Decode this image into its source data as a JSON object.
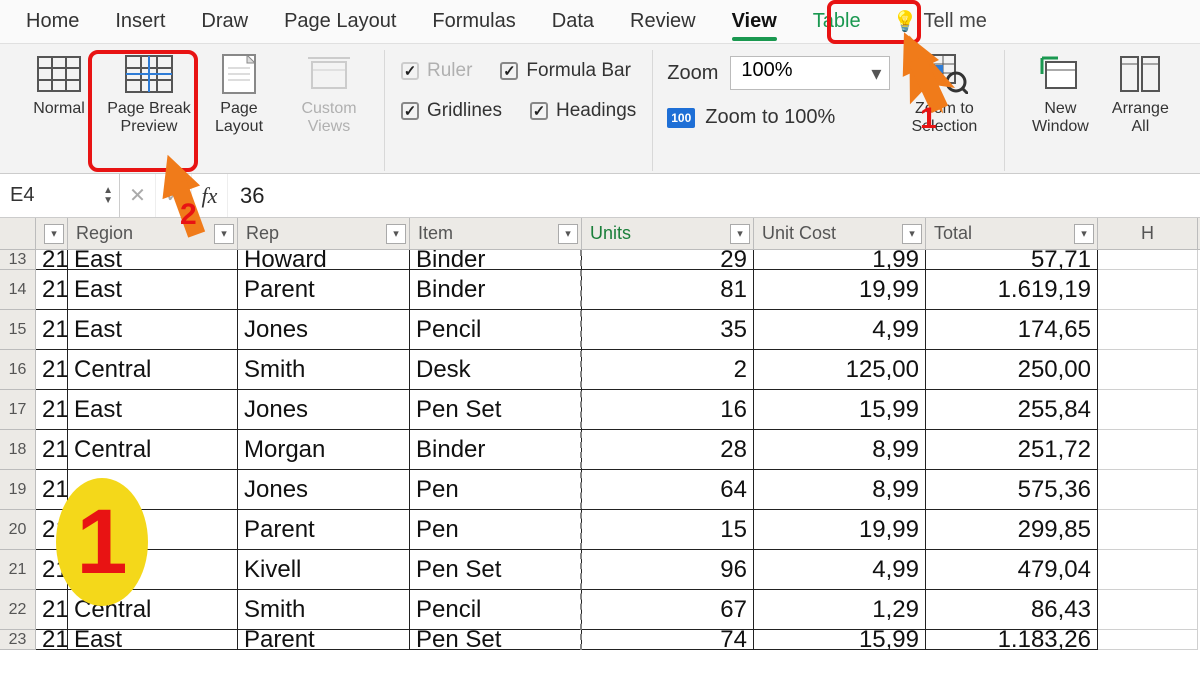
{
  "menu": {
    "items": [
      "Home",
      "Insert",
      "Draw",
      "Page Layout",
      "Formulas",
      "Data",
      "Review",
      "View",
      "Table"
    ],
    "active": "View",
    "tellme": "Tell me"
  },
  "ribbon": {
    "views": {
      "normal": "Normal",
      "page_break": "Page Break\nPreview",
      "page_layout": "Page\nLayout",
      "custom_views": "Custom\nViews"
    },
    "show": {
      "ruler": "Ruler",
      "formula_bar": "Formula Bar",
      "gridlines": "Gridlines",
      "headings": "Headings"
    },
    "zoom": {
      "label": "Zoom",
      "value": "100%",
      "to100": "Zoom to 100%",
      "to_selection": "Zoom to\nSelection"
    },
    "window": {
      "new_window": "New\nWindow",
      "arrange_all": "Arrange\nAll"
    }
  },
  "formula_bar": {
    "cell_ref": "E4",
    "value": "36"
  },
  "columns": {
    "A": "",
    "B": "Region",
    "C": "Rep",
    "D": "Item",
    "E": "Units",
    "F": "Unit Cost",
    "G": "Total",
    "H": "H"
  },
  "rows": [
    {
      "n": "13",
      "a": "21",
      "region": "East",
      "rep": "Howard",
      "item": "Binder",
      "units": "29",
      "cost": "1,99",
      "total": "57,71"
    },
    {
      "n": "14",
      "a": "21",
      "region": "East",
      "rep": "Parent",
      "item": "Binder",
      "units": "81",
      "cost": "19,99",
      "total": "1.619,19"
    },
    {
      "n": "15",
      "a": "21",
      "region": "East",
      "rep": "Jones",
      "item": "Pencil",
      "units": "35",
      "cost": "4,99",
      "total": "174,65"
    },
    {
      "n": "16",
      "a": "21",
      "region": "Central",
      "rep": "Smith",
      "item": "Desk",
      "units": "2",
      "cost": "125,00",
      "total": "250,00"
    },
    {
      "n": "17",
      "a": "21",
      "region": "East",
      "rep": "Jones",
      "item": "Pen Set",
      "units": "16",
      "cost": "15,99",
      "total": "255,84"
    },
    {
      "n": "18",
      "a": "21",
      "region": "Central",
      "rep": "Morgan",
      "item": "Binder",
      "units": "28",
      "cost": "8,99",
      "total": "251,72"
    },
    {
      "n": "19",
      "a": "21",
      "region": "",
      "rep": "Jones",
      "item": "Pen",
      "units": "64",
      "cost": "8,99",
      "total": "575,36"
    },
    {
      "n": "20",
      "a": "21",
      "region": "",
      "rep": "Parent",
      "item": "Pen",
      "units": "15",
      "cost": "19,99",
      "total": "299,85"
    },
    {
      "n": "21",
      "a": "21",
      "region": "al",
      "rep": "Kivell",
      "item": "Pen Set",
      "units": "96",
      "cost": "4,99",
      "total": "479,04"
    },
    {
      "n": "22",
      "a": "21",
      "region": "Central",
      "rep": "Smith",
      "item": "Pencil",
      "units": "67",
      "cost": "1,29",
      "total": "86,43"
    },
    {
      "n": "23",
      "a": "21",
      "region": "East",
      "rep": "Parent",
      "item": "Pen Set",
      "units": "74",
      "cost": "15,99",
      "total": "1.183,26"
    }
  ],
  "annotations": {
    "num1": "1",
    "num2": "2",
    "big_oval": "1"
  }
}
